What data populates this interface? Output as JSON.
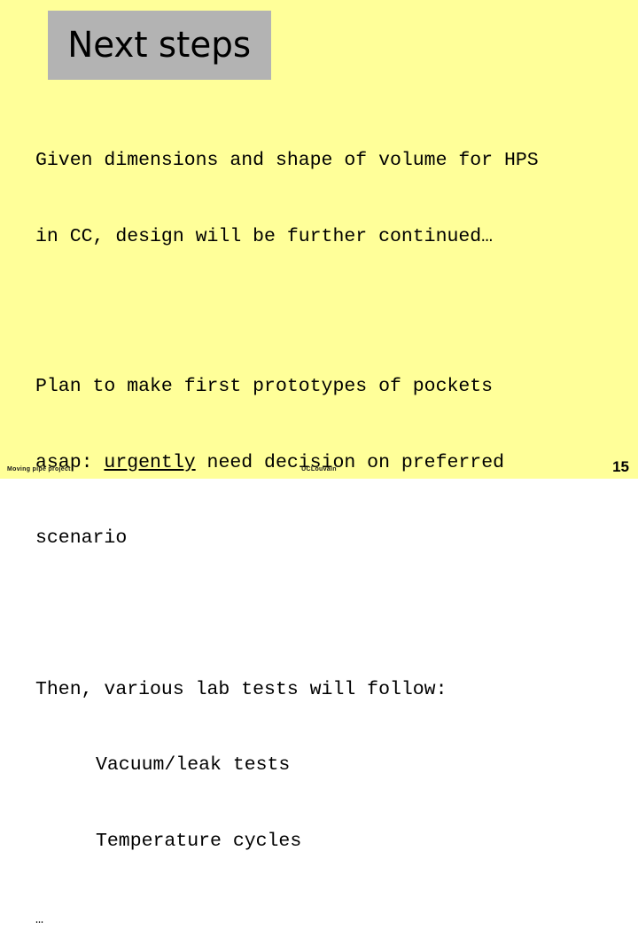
{
  "slide": {
    "background_color": "#ffff99",
    "title": {
      "text": "Next steps",
      "box_color": "#b3b3b3",
      "text_color": "#000000"
    },
    "body": {
      "paragraph_1": {
        "line_1": "Given dimensions and shape of volume for HPS",
        "line_2": "in CC, design will be further continued…"
      },
      "paragraph_2": {
        "line_1": "Plan to make first prototypes of pockets",
        "line_2_prefix": "asap: ",
        "line_2_emphasis": "urgently",
        "line_2_suffix": " need decision on preferred",
        "line_3": "scenario"
      },
      "paragraph_3": {
        "line_1": "Then, various lab tests will follow:",
        "sub_item_1": "Vacuum/leak tests",
        "sub_item_2": "Temperature cycles"
      },
      "trailing_ellipsis": "…"
    },
    "footer": {
      "left": "Moving pipe project",
      "center": "UCLouvain",
      "page_number": "15"
    }
  }
}
